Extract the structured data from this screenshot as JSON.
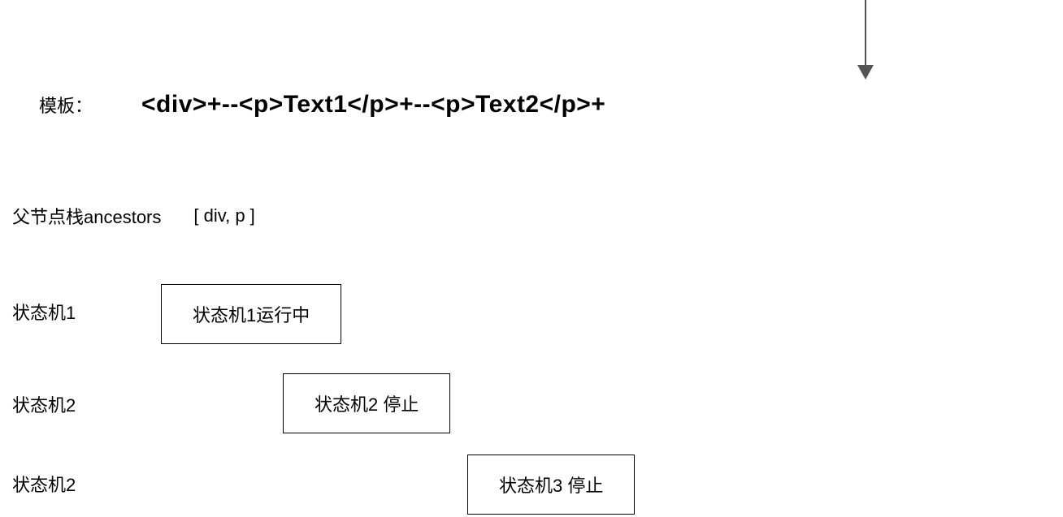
{
  "template": {
    "label": "模板：",
    "code": "<div>+--<p>Text1</p>+--<p>Text2</p>+"
  },
  "ancestors": {
    "label": "父节点栈ancestors",
    "value": "[ div,  p  ]"
  },
  "stateMachines": [
    {
      "label": "状态机1",
      "boxText": "状态机1运行中"
    },
    {
      "label": "状态机2",
      "boxText": "状态机2 停止"
    },
    {
      "label": "状态机2",
      "boxText": "状态机3 停止"
    }
  ]
}
